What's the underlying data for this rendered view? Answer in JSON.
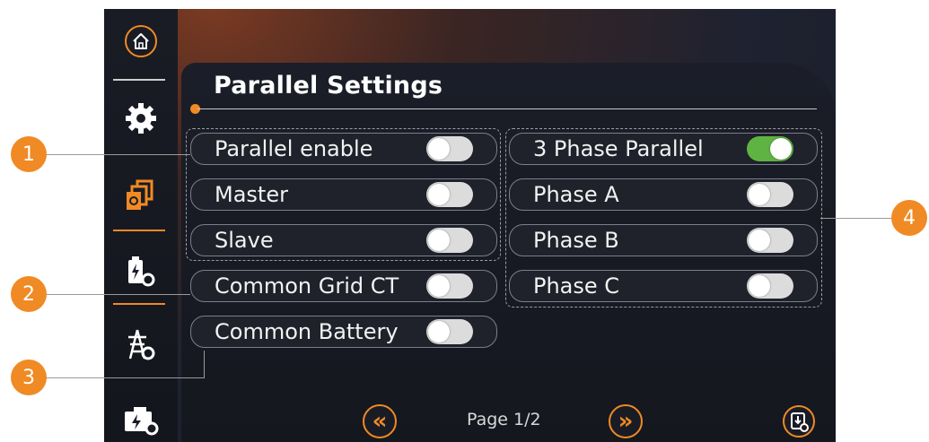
{
  "title": "Parallel Settings",
  "left_rows": [
    {
      "label": "Parallel enable",
      "on": false
    },
    {
      "label": "Master",
      "on": false
    },
    {
      "label": "Slave",
      "on": false
    },
    {
      "label": "Common Grid CT",
      "on": false
    },
    {
      "label": "Common Battery",
      "on": false
    }
  ],
  "right_rows": [
    {
      "label": "3 Phase Parallel",
      "on": true
    },
    {
      "label": "Phase A",
      "on": false
    },
    {
      "label": "Phase B",
      "on": false
    },
    {
      "label": "Phase C",
      "on": false
    }
  ],
  "pagination": {
    "label": "Page 1/2",
    "prev_glyph": "«",
    "next_glyph": "»"
  },
  "callouts": [
    "1",
    "2",
    "3",
    "4"
  ],
  "sidebar": [
    "home-icon",
    "gear-icon",
    "parallel-settings-icon",
    "battery-settings-icon",
    "grid-settings-icon",
    "generator-settings-icon"
  ],
  "colors": {
    "accent": "#f08a24",
    "toggle_on": "#5fb342",
    "toggle_off": "#dcdcdc"
  }
}
